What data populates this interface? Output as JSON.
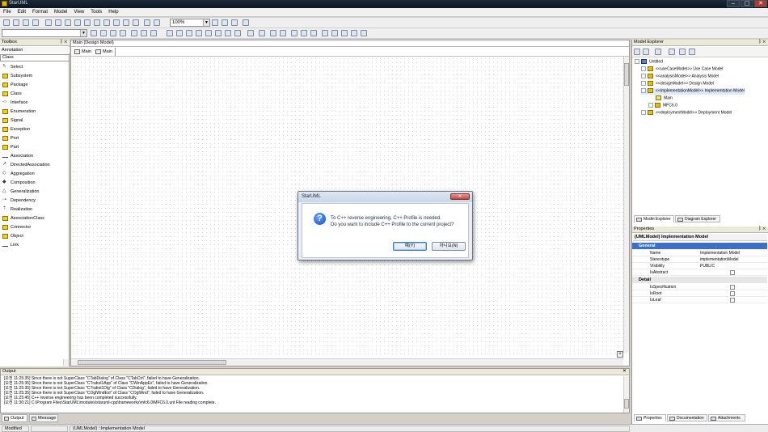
{
  "window": {
    "title": "StarUML",
    "minimize": "‒",
    "maximize": "▢",
    "close": "✕"
  },
  "menu": [
    "File",
    "Edit",
    "Format",
    "Model",
    "View",
    "Tools",
    "Help"
  ],
  "toolbar": {
    "zoom": "100%"
  },
  "toolbox": {
    "title": "Toolbox",
    "section": "Annotation",
    "category": "Class",
    "items": [
      "Select",
      "Subsystem",
      "Package",
      "Class",
      "Interface",
      "Enumeration",
      "Signal",
      "Exception",
      "Port",
      "Part",
      "Association",
      "DirectedAssociation",
      "Aggregation",
      "Composition",
      "Generalization",
      "Dependency",
      "Realization",
      "AssociationClass",
      "Connector",
      "Object",
      "Link"
    ]
  },
  "diagram": {
    "title": "Main (Design Model)",
    "tabs": [
      "Main",
      "Main"
    ]
  },
  "model_explorer": {
    "title": "Model Explorer",
    "tree": [
      "Untitled",
      "<<useCaseModel>> Use Case Model",
      "<<analysisModel>> Analysis Model",
      "<<designModel>> Design Model",
      "<<implementationModel>> Implementation Model",
      "Main",
      "MFC6.0",
      "<<deploymentModel>> Deployment Model"
    ],
    "tabs": [
      "Model Explorer",
      "Diagram Explorer"
    ]
  },
  "properties": {
    "title": "Properties",
    "header": "(UMLModel) Implementation Model",
    "general_label": "General",
    "general": [
      {
        "key": "Name",
        "value": "Implementation Model"
      },
      {
        "key": "Stereotype",
        "value": "implementationModel"
      },
      {
        "key": "Visibility",
        "value": "PUBLIC"
      },
      {
        "key": "IsAbstract",
        "value": ""
      }
    ],
    "detail_label": "Detail",
    "detail": [
      {
        "key": "IsSpecification",
        "value": ""
      },
      {
        "key": "IsRoot",
        "value": ""
      },
      {
        "key": "IsLeaf",
        "value": ""
      }
    ],
    "tabs": [
      "Properties",
      "Documentation",
      "Attachments"
    ]
  },
  "output": {
    "title": "Output",
    "lines": [
      "[오전 11:25:35]  Since there is not SuperClass \"CTabDialog\" of Class \"CTabCtrl\", failed to have Generalization.",
      "[오전 11:25:35]  Since there is not SuperClass \"CTrabol1App\" of Class \"CWinAppEx\", failed to have Generalization.",
      "[오전 11:25:35]  Since there is not SuperClass \"CTrabol1Dlg\" of Class \"CDialog\", failed to have Generalization.",
      "[오전 11:25:35]  Since there is not SuperClass \"COglWndExt\" of Class \"COglWnd\", failed to have Generalization.",
      "[오전 11:25:45]  C++ reverse engineering has been completed successfully.",
      "[오전 11:30:21]  C:\\Program Files\\StarUML\\modules\\staruml-cpp\\frameworks\\mfc6.0\\MFC6.0.unt File reading complete."
    ],
    "tabs": [
      "Output",
      "Message"
    ]
  },
  "statusbar": {
    "mode": "Modified",
    "selection": "(UMLModel) ::Implementation Model"
  },
  "dialog": {
    "title": "StarUML",
    "line1": "To C++ reverse engineering, C++ Profile is needed.",
    "line2": "Do you want to include C++ Profile to the current project?",
    "yes": "예(Y)",
    "no": "아니요(N)"
  }
}
